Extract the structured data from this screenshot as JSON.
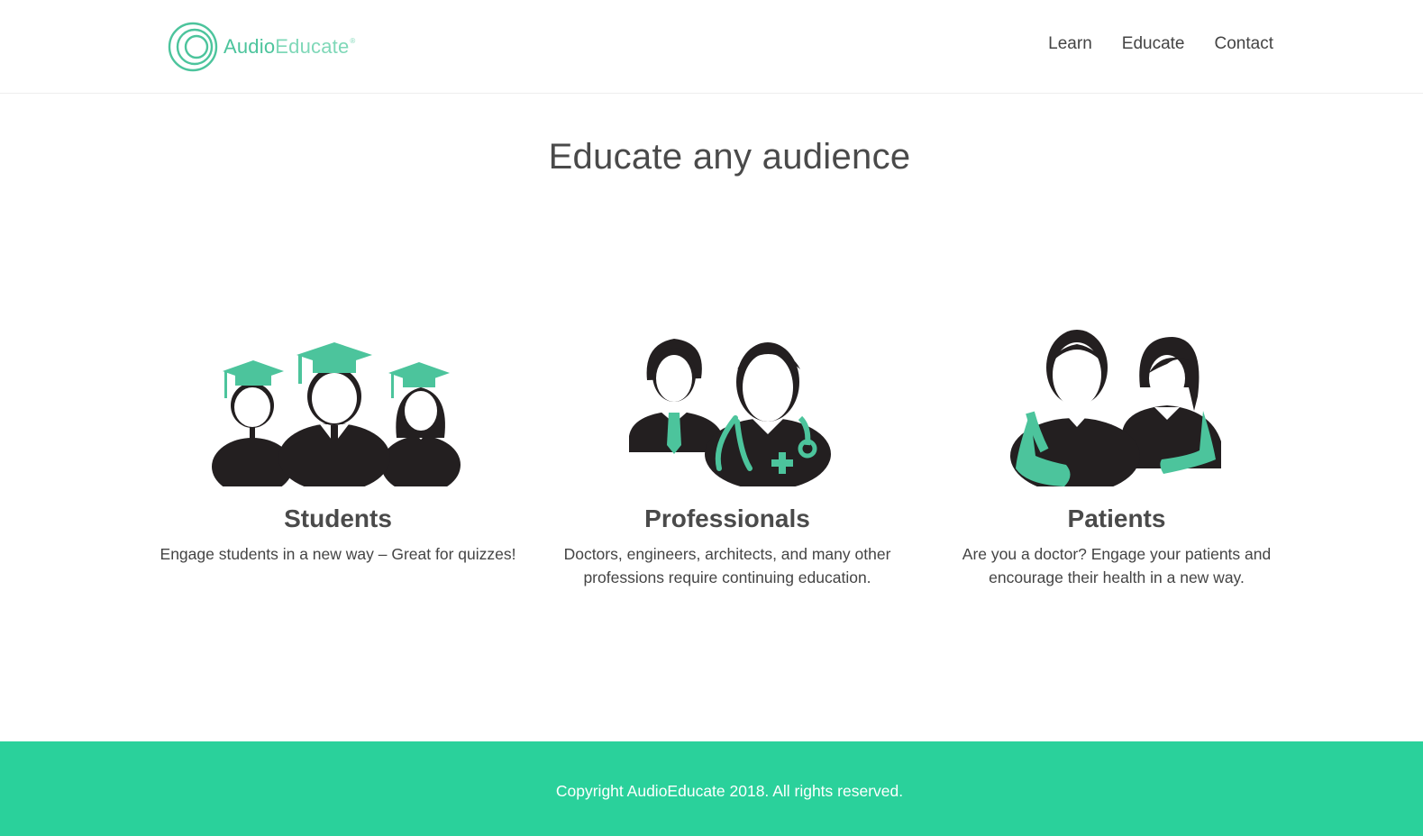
{
  "header": {
    "logo": {
      "brand_part1": "Audio",
      "brand_part2": "Educate",
      "mark": "®"
    },
    "nav": [
      {
        "label": "Learn"
      },
      {
        "label": "Educate"
      },
      {
        "label": "Contact"
      }
    ]
  },
  "main": {
    "headline": "Educate any audience",
    "audiences": [
      {
        "icon": "students-graduation-icon",
        "title": "Students",
        "description": "Engage students in a new way – Great for quizzes!"
      },
      {
        "icon": "professionals-doctor-icon",
        "title": "Professionals",
        "description": "Doctors, engineers, architects, and many other professions require continuing education."
      },
      {
        "icon": "patients-icon",
        "title": "Patients",
        "description": "Are you a doctor? Engage your patients and encourage their health in a new way."
      }
    ]
  },
  "footer": {
    "copyright": "Copyright AudioEducate 2018. All rights reserved."
  },
  "colors": {
    "accent": "#4cc49c",
    "footer_bg": "#2ad19b",
    "figure_dark": "#231f20",
    "text": "#444444"
  }
}
